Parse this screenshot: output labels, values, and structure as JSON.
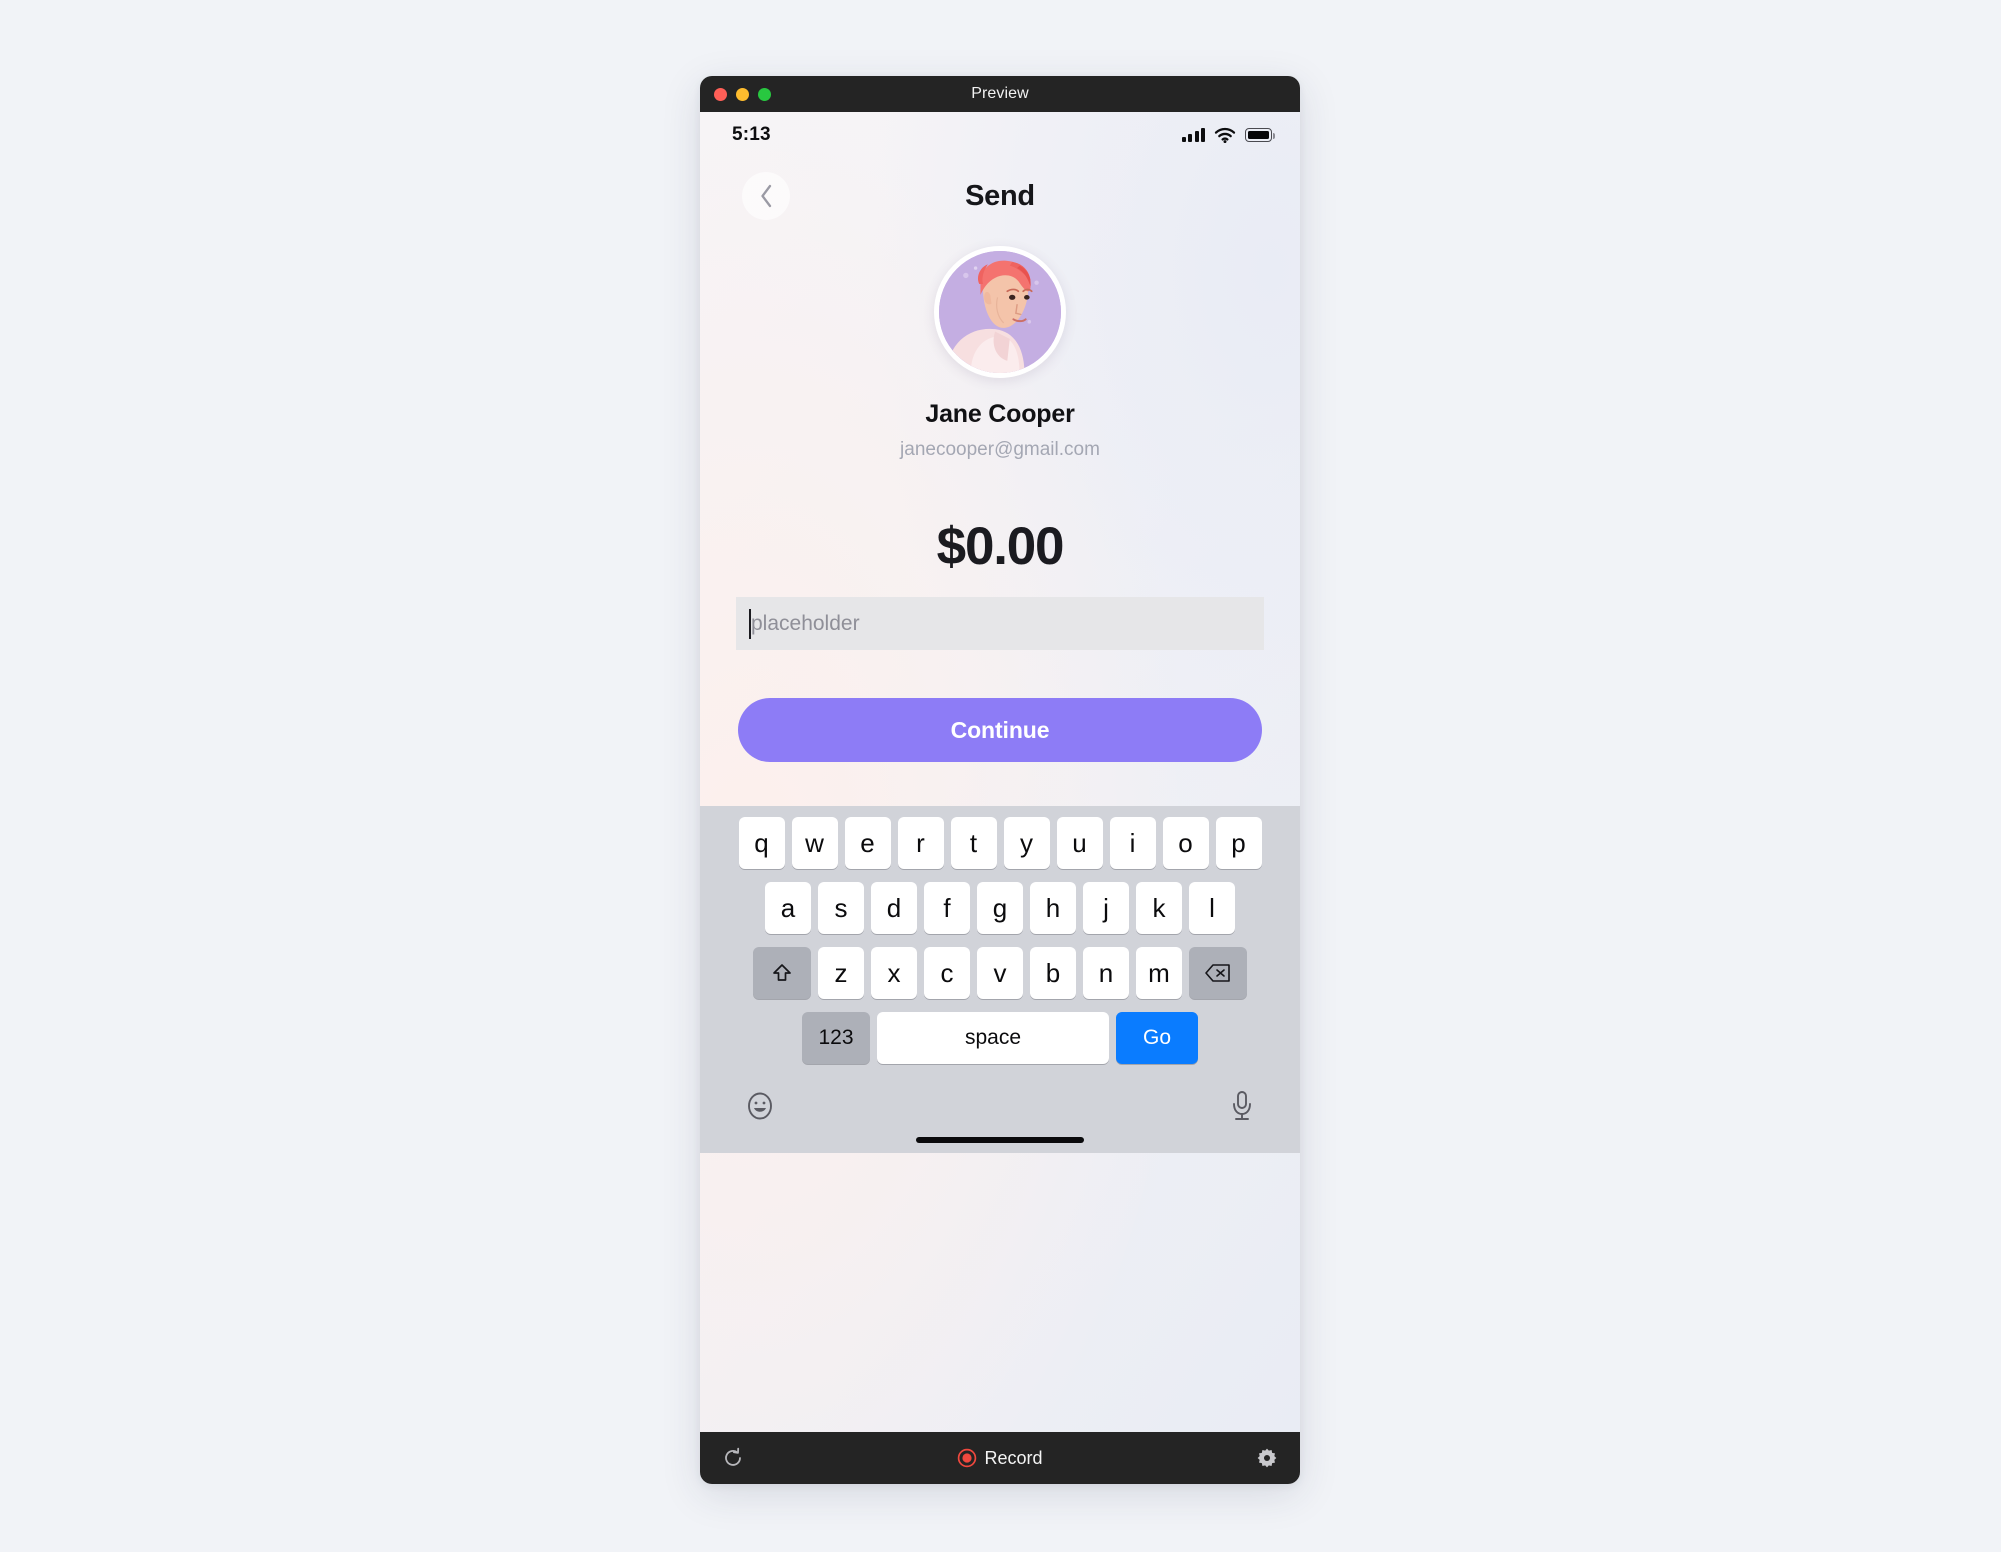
{
  "window": {
    "title": "Preview",
    "traffic_lights": [
      "close-red",
      "minimize-yellow",
      "maximize-green"
    ]
  },
  "status_bar": {
    "time": "5:13",
    "icons": [
      "cellular-signal-icon",
      "wifi-icon",
      "battery-icon"
    ]
  },
  "nav": {
    "back_icon": "chevron-left-icon",
    "title": "Send"
  },
  "profile": {
    "avatar_alt": "avatar",
    "name": "Jane Cooper",
    "email": "janecooper@gmail.com"
  },
  "amount": {
    "value": "$0.00"
  },
  "input": {
    "value": "",
    "placeholder": "placeholder"
  },
  "actions": {
    "continue_label": "Continue"
  },
  "keyboard": {
    "row1": [
      "q",
      "w",
      "e",
      "r",
      "t",
      "y",
      "u",
      "i",
      "o",
      "p"
    ],
    "row2": [
      "a",
      "s",
      "d",
      "f",
      "g",
      "h",
      "j",
      "k",
      "l"
    ],
    "row3": [
      "z",
      "x",
      "c",
      "v",
      "b",
      "n",
      "m"
    ],
    "shift_icon": "shift-arrow-icon",
    "backspace_icon": "backspace-icon",
    "numbers_label": "123",
    "space_label": "space",
    "go_label": "Go",
    "emoji_icon": "emoji-smiley-icon",
    "mic_icon": "microphone-icon"
  },
  "toolbar": {
    "reload_icon": "reload-icon",
    "record_label": "Record",
    "settings_icon": "gear-icon"
  },
  "colors": {
    "accent_purple": "#8d7cf6",
    "go_blue": "#0a7cff",
    "record_red": "#f0483e",
    "keyboard_bg": "#d1d3d9",
    "titlebar_bg": "#242424",
    "page_bg": "#f1f3f7"
  }
}
